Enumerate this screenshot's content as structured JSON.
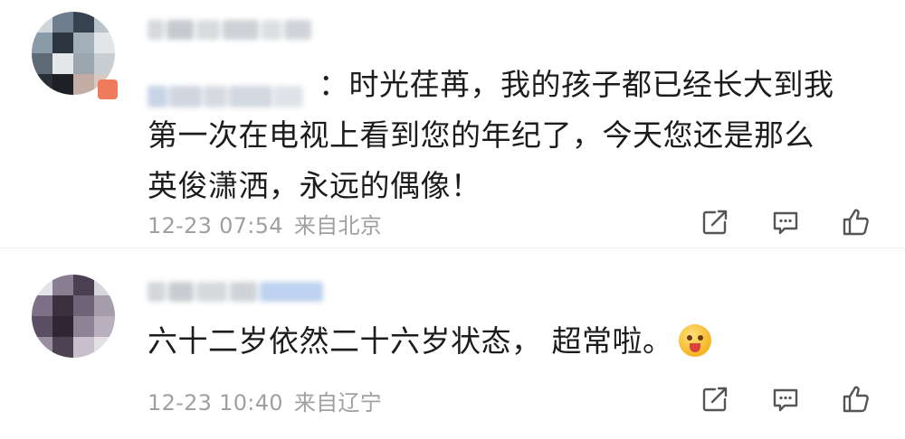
{
  "comments": [
    {
      "reply_colon": "：",
      "text_line1": "时光荏苒，我的孩子都已经长大到我",
      "text_line2": "第一次在电视上看到您的年纪了，今天您还是那么",
      "text_line3": "英俊潇洒，永远的偶像！",
      "time": "12-23 07:54",
      "location": "来自北京",
      "icons": {
        "share": "share-icon",
        "comment": "comment-icon",
        "like": "thumbs-up-icon"
      }
    },
    {
      "text": "六十二岁依然二十六岁状态， 超常啦。",
      "emoji": "tongue-emoji",
      "time": "12-23 10:40",
      "location": "来自辽宁",
      "icons": {
        "share": "share-icon",
        "comment": "comment-icon",
        "like": "thumbs-up-icon"
      }
    }
  ],
  "colors": {
    "text": "#1c1c1c",
    "meta": "#a0a0a0",
    "icon": "#555555",
    "divider": "#ececec"
  }
}
